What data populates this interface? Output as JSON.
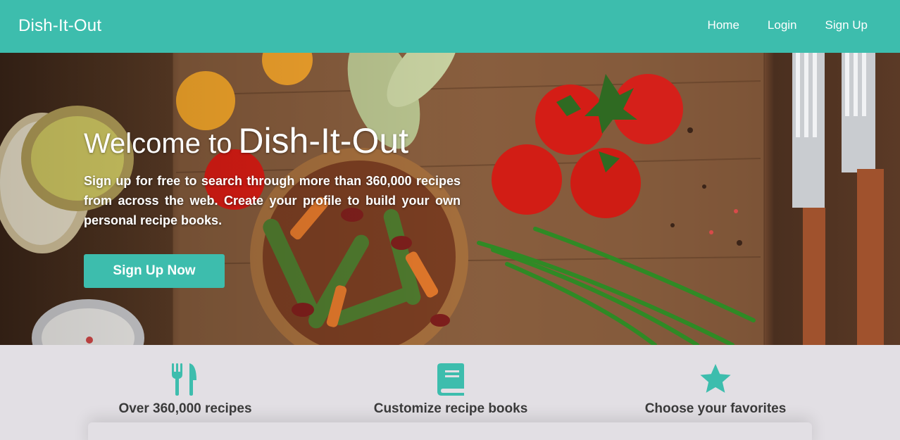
{
  "navbar": {
    "brand": "Dish-It-Out",
    "links": [
      "Home",
      "Login",
      "Sign Up"
    ]
  },
  "hero": {
    "title_prefix": "Welcome to",
    "title_brand": "Dish-It-Out",
    "text": "Sign up for free to search through more than 360,000 recipes from across the web. Create your profile to build your own personal recipe books.",
    "cta_label": "Sign Up Now"
  },
  "features": [
    {
      "icon": "utensils-icon",
      "label": "Over 360,000 recipes"
    },
    {
      "icon": "book-icon",
      "label": "Customize recipe books"
    },
    {
      "icon": "star-icon",
      "label": "Choose your favorites"
    }
  ],
  "colors": {
    "accent": "#3dbdad",
    "background": "#e2dfe4",
    "text_dark": "#3a3a3a"
  }
}
